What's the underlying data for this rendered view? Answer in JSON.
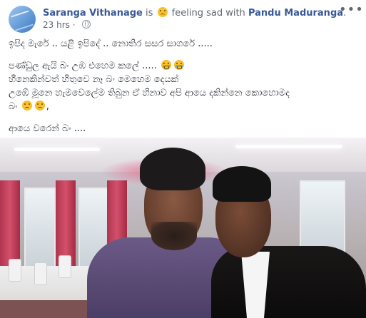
{
  "header": {
    "author": "Saranga Vithanage",
    "is_text": "is",
    "feeling_text": "feeling sad with",
    "tagged": "Pandu Maduranga",
    "tagged_suffix": ".",
    "timestamp": "23 hrs",
    "separator": "·",
    "privacy_icon": "globe-icon",
    "more_icon": "more-options-icon"
  },
  "post": {
    "line1": "ඉපිද මැරේ .. යළි ඉපිදේ .. නොතිර සසර සාගරේ .....",
    "line2": "පණ්ඩුල ඇයි බං උඹ එහෙම කලේ .....",
    "line3": "හීනෙකින්වත් හිතුවෙ නෑ බං මෙහෙම දෙයක්",
    "line4": "උඹේ මූනෙ හැමවෙලේම තිබුන ඒ හිනාව අපි ආයෙ දකින්නෙ කොහොමද",
    "line5": "බං",
    "line5_suffix": ",",
    "line6": "ආයෙ වරෙන් බං ....",
    "emoji_feeling": "sad-face-emoji",
    "emoji_line2": "crying-face-emoji",
    "emoji_line5": "sad-face-emoji"
  },
  "colors": {
    "author_link": "#385898",
    "muted": "#606770",
    "text": "#1d2129"
  }
}
